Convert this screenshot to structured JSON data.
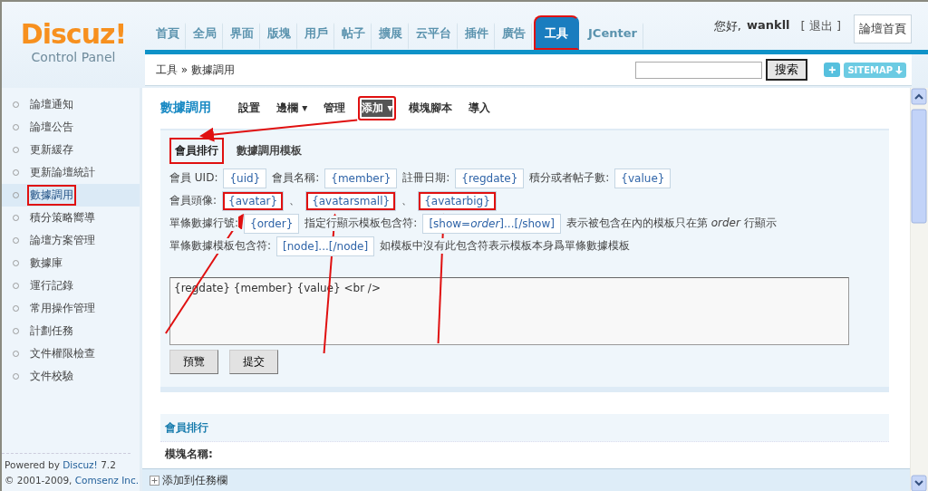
{
  "logo": {
    "title": "Discuz!",
    "subtitle": "Control Panel"
  },
  "nav": [
    {
      "label": "首頁",
      "selected": false,
      "highlighted": false
    },
    {
      "label": "全局",
      "selected": false,
      "highlighted": false
    },
    {
      "label": "界面",
      "selected": false,
      "highlighted": false
    },
    {
      "label": "版塊",
      "selected": false,
      "highlighted": false
    },
    {
      "label": "用戶",
      "selected": false,
      "highlighted": false
    },
    {
      "label": "帖子",
      "selected": false,
      "highlighted": false
    },
    {
      "label": "擴展",
      "selected": false,
      "highlighted": false
    },
    {
      "label": "云平台",
      "selected": false,
      "highlighted": false
    },
    {
      "label": "插件",
      "selected": false,
      "highlighted": false
    },
    {
      "label": "廣告",
      "selected": false,
      "highlighted": false
    },
    {
      "label": "工具",
      "selected": true,
      "highlighted": true
    },
    {
      "label": "JCenter",
      "selected": false,
      "highlighted": false
    }
  ],
  "user": {
    "greeting": "您好,",
    "name": "wankll",
    "logout": "[ 退出 ]",
    "home_button": "論壇首頁"
  },
  "breadcrumb": "工具 » 數據調用",
  "search": {
    "button": "搜索"
  },
  "quick_buttons": {
    "add": "+",
    "sitemap": "SITEMAP"
  },
  "sidebar": {
    "items": [
      {
        "label": "論壇通知",
        "selected": false,
        "highlighted": false
      },
      {
        "label": "論壇公告",
        "selected": false,
        "highlighted": false
      },
      {
        "label": "更新緩存",
        "selected": false,
        "highlighted": false
      },
      {
        "label": "更新論壇統計",
        "selected": false,
        "highlighted": false
      },
      {
        "label": "數據調用",
        "selected": true,
        "highlighted": true
      },
      {
        "label": "積分策略嚮導",
        "selected": false,
        "highlighted": false
      },
      {
        "label": "論壇方案管理",
        "selected": false,
        "highlighted": false
      },
      {
        "label": "數據庫",
        "selected": false,
        "highlighted": false
      },
      {
        "label": "運行記錄",
        "selected": false,
        "highlighted": false
      },
      {
        "label": "常用操作管理",
        "selected": false,
        "highlighted": false
      },
      {
        "label": "計劃任務",
        "selected": false,
        "highlighted": false
      },
      {
        "label": "文件權限檢查",
        "selected": false,
        "highlighted": false
      },
      {
        "label": "文件校驗",
        "selected": false,
        "highlighted": false
      }
    ],
    "footer_prefix": "Powered by",
    "footer_link": "Discuz!",
    "footer_version": "7.2",
    "copyright": "© 2001-2009,",
    "copyright_link": "Comsenz Inc."
  },
  "page_title": "數據調用",
  "actions": [
    {
      "label": "設置",
      "selected": false,
      "highlighted": false
    },
    {
      "label": "邊欄",
      "caret": "▾",
      "selected": false,
      "highlighted": false
    },
    {
      "label": "管理",
      "selected": false,
      "highlighted": false
    },
    {
      "label": "添加",
      "caret": "▾",
      "selected": true,
      "highlighted": true
    },
    {
      "label": "模塊腳本",
      "selected": false,
      "highlighted": false
    },
    {
      "label": "導入",
      "selected": false,
      "highlighted": false
    }
  ],
  "tabs": [
    {
      "label": "會員排行",
      "selected": true,
      "highlighted": true,
      "arrow": true
    },
    {
      "label": "數據調用模板",
      "selected": false,
      "highlighted": false,
      "arrow": false
    }
  ],
  "token_rows": [
    {
      "parts": [
        {
          "kind": "label",
          "text": "會員 UID:"
        },
        {
          "kind": "token",
          "text": "{uid}",
          "highlighted": false
        },
        {
          "kind": "label",
          "text": "會員名稱:"
        },
        {
          "kind": "token",
          "text": "{member}",
          "highlighted": false
        },
        {
          "kind": "label",
          "text": "註冊日期:"
        },
        {
          "kind": "token",
          "text": "{regdate}",
          "highlighted": false
        },
        {
          "kind": "label",
          "text": "積分或者帖子數:"
        },
        {
          "kind": "token",
          "text": "{value}",
          "highlighted": false
        }
      ]
    },
    {
      "parts": [
        {
          "kind": "label",
          "text": "會員頭像:"
        },
        {
          "kind": "token",
          "text": "{avatar}",
          "highlighted": true,
          "arrow": true
        },
        {
          "kind": "sep",
          "text": "、"
        },
        {
          "kind": "token",
          "text": "{avatarsmall}",
          "highlighted": true,
          "arrow": true
        },
        {
          "kind": "sep",
          "text": "、"
        },
        {
          "kind": "token",
          "text": "{avatarbig}",
          "highlighted": true,
          "arrow": true
        }
      ]
    },
    {
      "parts": [
        {
          "kind": "label",
          "text": "單條數據行號:"
        },
        {
          "kind": "token",
          "text": "{order}",
          "highlighted": false
        },
        {
          "kind": "label",
          "text": "指定行顯示模板包含符:"
        },
        {
          "kind": "token",
          "text": "[show=*order*]...[/show]",
          "highlighted": false
        },
        {
          "kind": "label",
          "text": "表示被包含在內的模板只在第 *order* 行顯示"
        }
      ]
    },
    {
      "parts": [
        {
          "kind": "label",
          "text": "單條數據模板包含符:"
        },
        {
          "kind": "token",
          "text": "[node]...[/node]",
          "highlighted": false
        },
        {
          "kind": "label",
          "text": "如模板中沒有此包含符表示模板本身爲單條數據模板"
        }
      ]
    }
  ],
  "editor": {
    "value": "{regdate} {member} {value} <br />"
  },
  "buttons": [
    "預覽",
    "提交"
  ],
  "section": {
    "title": "會員排行",
    "field_label": "模塊名稱:"
  },
  "taskbar_link": "添加到任務欄"
}
